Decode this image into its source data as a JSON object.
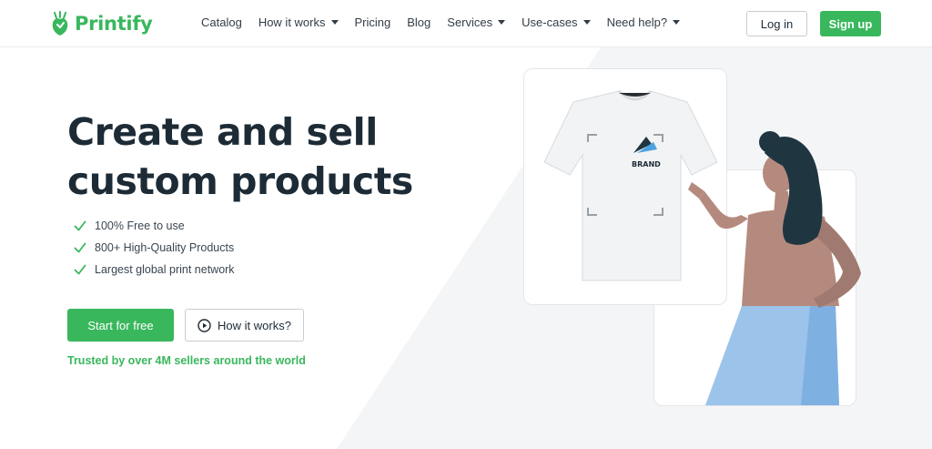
{
  "header": {
    "brand_name": "Printify",
    "nav": [
      {
        "label": "Catalog",
        "dropdown": false
      },
      {
        "label": "How it works",
        "dropdown": true
      },
      {
        "label": "Pricing",
        "dropdown": false
      },
      {
        "label": "Blog",
        "dropdown": false
      },
      {
        "label": "Services",
        "dropdown": true
      },
      {
        "label": "Use-cases",
        "dropdown": true
      },
      {
        "label": "Need help?",
        "dropdown": true
      }
    ],
    "login_label": "Log in",
    "signup_label": "Sign up"
  },
  "hero": {
    "title_line1": "Create and sell",
    "title_line2": "custom products",
    "features": [
      "100% Free to use",
      "800+ High-Quality Products",
      "Largest global print network"
    ],
    "start_label": "Start for free",
    "how_label": "How it works?",
    "trusted_text": "Trusted by over 4M sellers around the world"
  },
  "illustration": {
    "shirt_brand_text": "BRAND"
  },
  "colors": {
    "brand_green": "#39b75d",
    "text_dark": "#1d2b36",
    "skirt_blue": "#9cc3ea",
    "skin": "#b58a7e",
    "hair": "#1f3641"
  },
  "icons": [
    "logo-icon",
    "check-icon",
    "play-circle-icon",
    "chevron-down-icon"
  ]
}
